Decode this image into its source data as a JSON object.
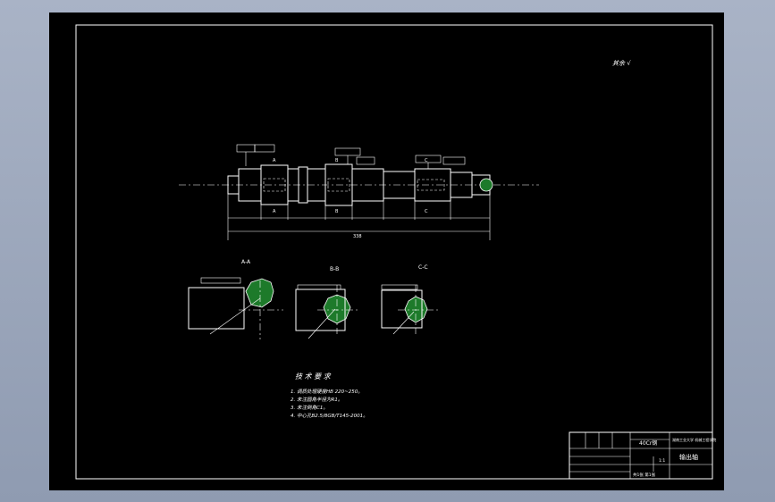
{
  "title_block": {
    "drawing_name": "输出轴",
    "material": "40Cr钢",
    "scale": "1:1",
    "sheet_info": "共1张 第1张",
    "school": "湖南工业大学 机械工程学院"
  },
  "corner_note": "其余 √",
  "sections": [
    {
      "label": "A-A"
    },
    {
      "label": "B-B"
    },
    {
      "label": "C-C"
    }
  ],
  "tech_req": {
    "heading": "技 术 要 求",
    "items": [
      "1. 调质处理硬度HB 220~250。",
      "2. 未注圆角半径为R1。",
      "3. 未注倒角C1。",
      "4. 中心孔B2.5/8GB/T145-2001。"
    ]
  },
  "dims": {
    "total_length": "338"
  },
  "colors": {
    "sheet_bg": "#000000",
    "line": "#ffffff",
    "hatch": "#1d7a2a"
  }
}
